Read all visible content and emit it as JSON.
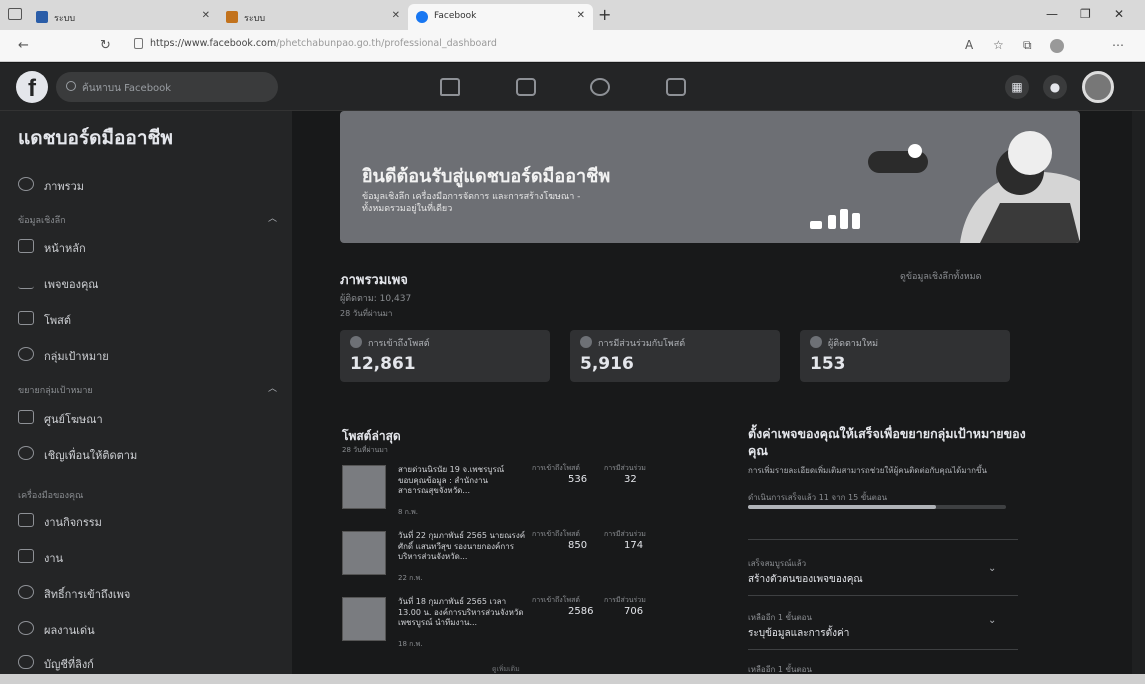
{
  "browser": {
    "tabs": [
      {
        "label": "ระบบ",
        "active": false,
        "fav_color": "#2a5da8"
      },
      {
        "label": "ระบบ",
        "active": false,
        "fav_color": "#c2721c"
      },
      {
        "label": "Facebook",
        "active": true,
        "fav_color": "#1877f2"
      }
    ],
    "new_tab": "+",
    "url_host": "https://www.facebook.com",
    "url_path": "/phetchabunpao.go.th/professional_dashboard"
  },
  "fb": {
    "logo": "f",
    "search_placeholder": "ค้นหาบน Facebook"
  },
  "sidebar": {
    "title": "แดชบอร์ดมืออาชีพ",
    "overview": "ภาพรวม",
    "section_main": "ข้อมูลเชิงลึก",
    "items_main": [
      "หน้าหลัก",
      "เพจของคุณ",
      "โพสต์",
      "กลุ่มเป้าหมาย"
    ],
    "section_audience": "ขยายกลุ่มเป้าหมาย",
    "items_audience": [
      "ศูนย์โฆษณา",
      "เชิญเพื่อนให้ติดตาม"
    ],
    "section_tools": "เครื่องมือของคุณ",
    "items_tools": [
      "งานกิจกรรม",
      "งาน",
      "สิทธิ์การเข้าถึงเพจ",
      "ผลงานเด่น",
      "บัญชีที่ลิงก์"
    ]
  },
  "banner": {
    "title": "ยินดีต้อนรับสู่แดชบอร์ดมืออาชีพ",
    "subtitle": "ข้อมูลเชิงลึก เครื่องมือการจัดการ และการสร้างโฆษณา - ทั้งหมดรวมอยู่ในที่เดียว"
  },
  "overview": {
    "title": "ภาพรวมเพจ",
    "followers": "ผู้ติดตาม: 10,437",
    "period": "28 วันที่ผ่านมา",
    "see_all": "ดูข้อมูลเชิงลึกทั้งหมด",
    "stats": [
      {
        "label": "การเข้าถึงโพสต์",
        "value": "12,861"
      },
      {
        "label": "การมีส่วนร่วมกับโพสต์",
        "value": "5,916"
      },
      {
        "label": "ผู้ติดตามใหม่",
        "value": "153"
      }
    ]
  },
  "recent_posts": {
    "title": "โพสต์ล่าสุด",
    "period": "28 วันที่ผ่านมา",
    "col_reach": "การเข้าถึงโพสต์",
    "col_engage": "การมีส่วนร่วม",
    "posts": [
      {
        "text": "สายด่วนนิรนัย 19 จ.เพชรบูรณ์ ขอบคุณข้อมูล : สำนักงานสาธารณสุขจังหวัด...",
        "date": "8 ก.พ.",
        "reach": "536",
        "engagement": "32"
      },
      {
        "text": "วันที่ 22 กุมภาพันธ์ 2565 นายณรงค์ศักดิ์ แสนทวีสุข รองนายกองค์การบริหารส่วนจังหวัด...",
        "date": "22 ก.พ.",
        "reach": "850",
        "engagement": "174"
      },
      {
        "text": "วันที่ 18 กุมภาพันธ์ 2565 เวลา 13.00 น. องค์การบริหารส่วนจังหวัดเพชรบูรณ์ นำทีมงาน...",
        "date": "18 ก.พ.",
        "reach": "2586",
        "engagement": "706"
      }
    ],
    "see_more": "ดูเพิ่มเติม"
  },
  "setup": {
    "title": "ตั้งค่าเพจของคุณให้เสร็จเพื่อขยายกลุ่มเป้าหมายของคุณ",
    "desc": "การเพิ่มรายละเอียดเพิ่มเติมสามารถช่วยให้ผู้คนติดต่อกับคุณได้มากขึ้น",
    "progress_text": "ดำเนินการเสร็จแล้ว 11 จาก 15 ขั้นตอน",
    "progress_fraction": 0.73,
    "steps": [
      {
        "sub": "เสร็จสมบูรณ์แล้ว",
        "title": "สร้างตัวตนของเพจของคุณ"
      },
      {
        "sub": "เหลืออีก 1 ขั้นตอน",
        "title": "ระบุข้อมูลและการตั้งค่า"
      },
      {
        "sub": "เหลืออีก 1 ขั้นตอน",
        "title": ""
      }
    ]
  }
}
